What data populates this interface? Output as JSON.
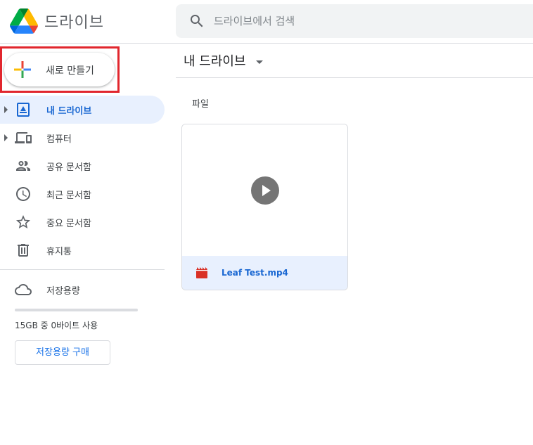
{
  "app": {
    "title": "드라이브"
  },
  "search": {
    "placeholder": "드라이브에서 검색"
  },
  "new_button": {
    "label": "새로 만들기"
  },
  "sidebar": {
    "items": [
      {
        "label": "내 드라이브",
        "icon": "my-drive-icon",
        "active": true,
        "expandable": true
      },
      {
        "label": "컴퓨터",
        "icon": "computer-icon",
        "active": false,
        "expandable": true
      },
      {
        "label": "공유 문서함",
        "icon": "shared-people-icon",
        "active": false,
        "expandable": false
      },
      {
        "label": "최근 문서함",
        "icon": "clock-icon",
        "active": false,
        "expandable": false
      },
      {
        "label": "중요 문서함",
        "icon": "star-icon",
        "active": false,
        "expandable": false
      },
      {
        "label": "휴지통",
        "icon": "trash-icon",
        "active": false,
        "expandable": false
      }
    ],
    "storage": {
      "label": "저장용량",
      "usage_text": "15GB 중 0바이트 사용",
      "used_fraction": 0,
      "buy_label": "저장용량 구매"
    }
  },
  "main": {
    "title": "내 드라이브",
    "section_label": "파일",
    "files": [
      {
        "name": "Leaf Test.mp4",
        "type": "video"
      }
    ]
  },
  "colors": {
    "accent": "#1a73e8",
    "active_bg": "#e8f0fe",
    "highlight_border": "#e1262d",
    "video_icon": "#d93025"
  }
}
